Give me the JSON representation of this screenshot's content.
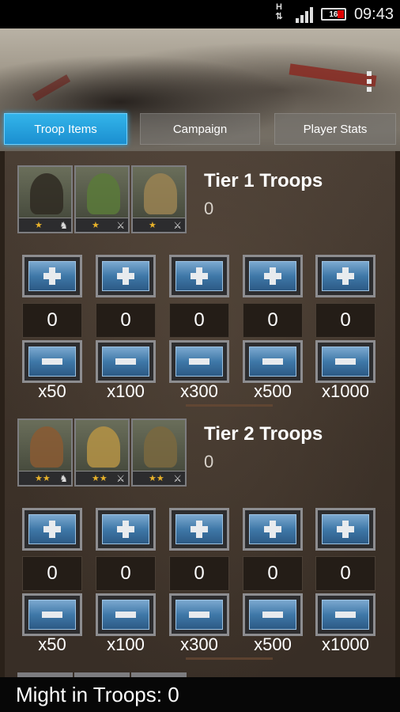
{
  "status_bar": {
    "network": "H",
    "battery": "16",
    "time": "09:43"
  },
  "tabs": [
    {
      "label": "Troop Items",
      "active": true
    },
    {
      "label": "Campaign",
      "active": false
    },
    {
      "label": "Player Stats",
      "active": false
    }
  ],
  "tiers": [
    {
      "title": "Tier 1 Troops",
      "count": "0",
      "stars": "★",
      "portrait_icons": [
        "cavalry-icon",
        "sword-icon",
        "bow-icon"
      ],
      "multipliers": [
        "x50",
        "x100",
        "x300",
        "x500",
        "x1000"
      ],
      "values": [
        "0",
        "0",
        "0",
        "0",
        "0"
      ]
    },
    {
      "title": "Tier 2 Troops",
      "count": "0",
      "stars": "★★",
      "portrait_icons": [
        "cavalry-icon",
        "sword-icon",
        "bow-icon"
      ],
      "multipliers": [
        "x50",
        "x100",
        "x300",
        "x500",
        "x1000"
      ],
      "values": [
        "0",
        "0",
        "0",
        "0",
        "0"
      ]
    }
  ],
  "footer": {
    "label": "Might in Troops: 0"
  },
  "colors": {
    "active_tab": "#1b8fd0",
    "button_blue": "#3f78a8",
    "star": "#e8b22a"
  }
}
